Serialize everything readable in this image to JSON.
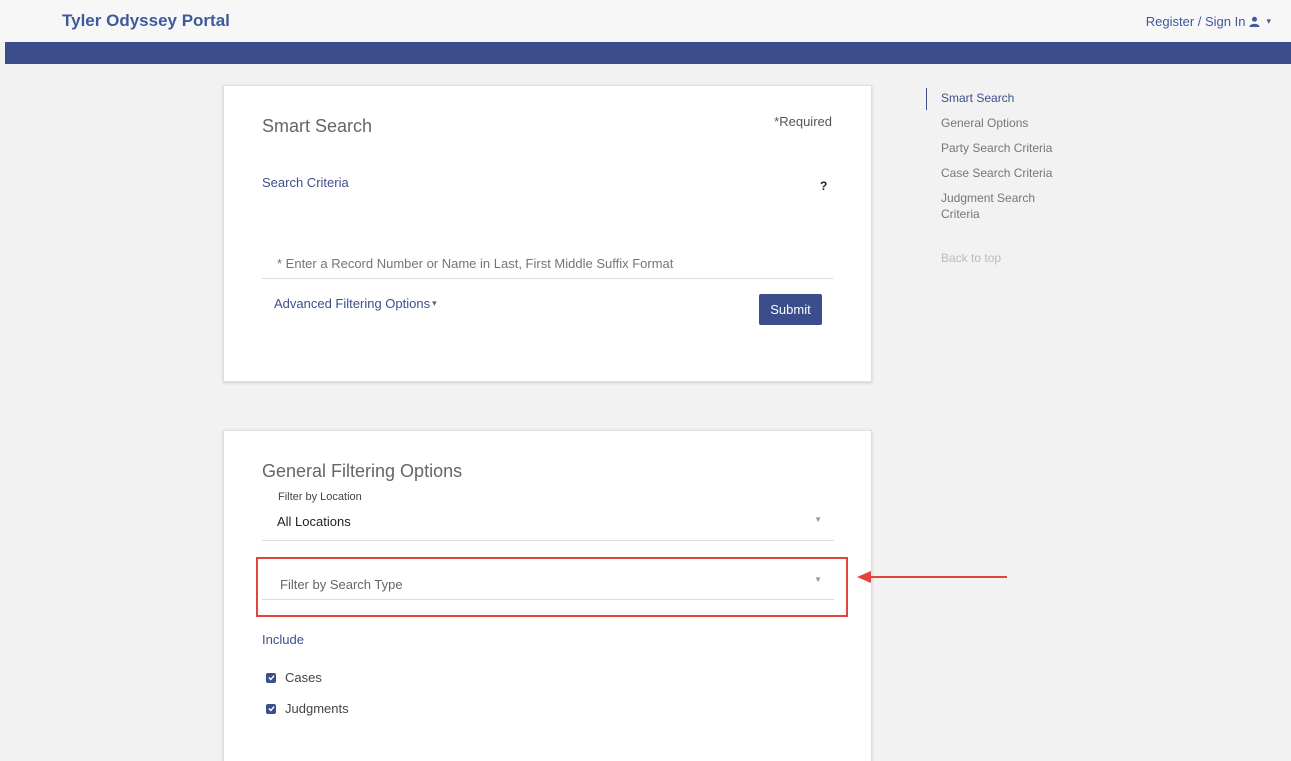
{
  "header": {
    "brand": "Tyler Odyssey Portal",
    "signin_label": "Register / Sign In",
    "user_icon": "user-icon",
    "caret": "▾"
  },
  "smart_search": {
    "title": "Smart Search",
    "required_label": "*Required",
    "criteria_label": "Search Criteria",
    "help_label": "?",
    "input_value": "",
    "input_placeholder": "* Enter a Record Number or Name in Last, First Middle Suffix Format",
    "advanced_label": "Advanced Filtering Options",
    "advanced_caret": "▾",
    "submit_label": "Submit"
  },
  "general_filtering": {
    "title": "General Filtering Options",
    "location_label": "Filter by Location",
    "location_value": "All Locations",
    "search_type_placeholder": "Filter by Search Type",
    "include_label": "Include",
    "checkboxes": [
      {
        "label": "Cases",
        "checked": true
      },
      {
        "label": "Judgments",
        "checked": true
      }
    ]
  },
  "side_nav": {
    "items": [
      {
        "label": "Smart Search",
        "active": true
      },
      {
        "label": "General Options",
        "active": false
      },
      {
        "label": "Party Search Criteria",
        "active": false
      },
      {
        "label": "Case Search Criteria",
        "active": false
      },
      {
        "label": "Judgment Search Criteria",
        "active": false
      }
    ],
    "back_to_top": "Back to top"
  },
  "colors": {
    "brand_blue": "#3d5a9c",
    "nav_bar": "#3c4d8c",
    "highlight_red": "#e3443a"
  }
}
